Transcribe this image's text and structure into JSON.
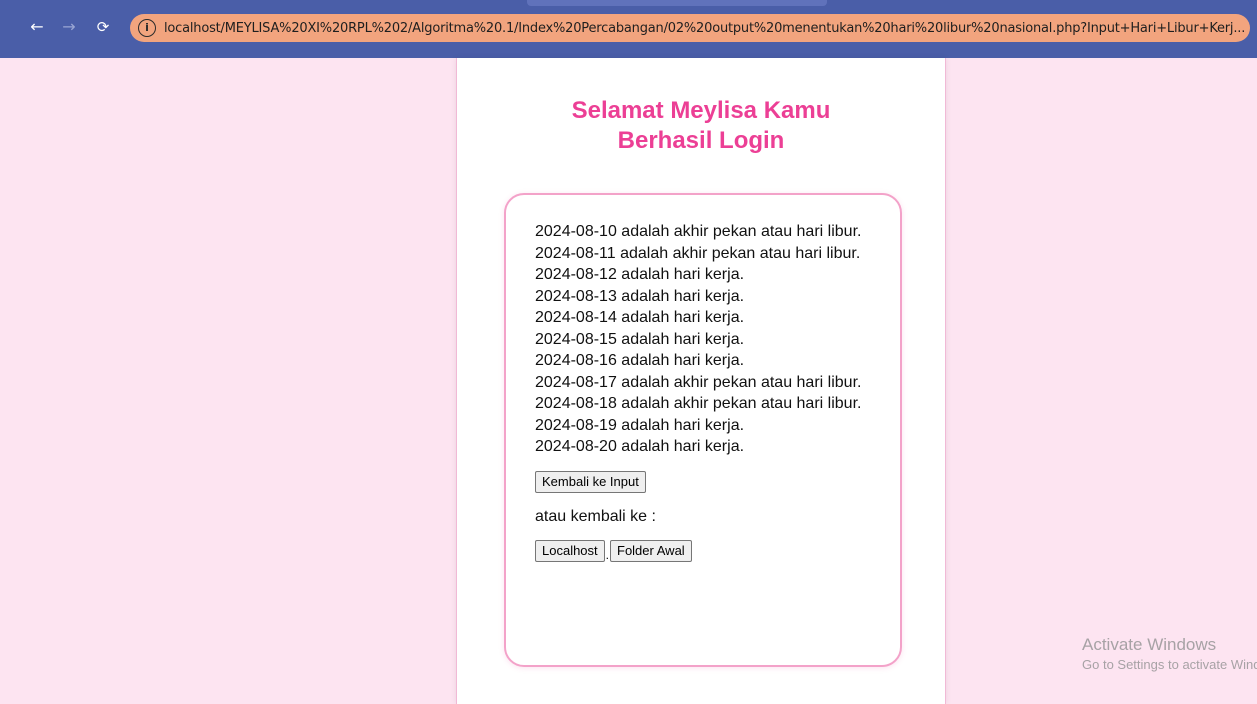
{
  "browser": {
    "url": "localhost/MEYLISA%20XI%20RPL%202/Algoritma%20.1/Index%20Percabangan/02%20output%20menentukan%20hari%20libur%20nasional.php?Input+Hari+Libur+Kerj..."
  },
  "page": {
    "title": "Selamat Meylisa Kamu Berhasil Login",
    "results": [
      "2024-08-10 adalah akhir pekan atau hari libur.",
      "2024-08-11 adalah akhir pekan atau hari libur.",
      "2024-08-12 adalah hari kerja.",
      "2024-08-13 adalah hari kerja.",
      "2024-08-14 adalah hari kerja.",
      "2024-08-15 adalah hari kerja.",
      "2024-08-16 adalah hari kerja.",
      "2024-08-17 adalah akhir pekan atau hari libur.",
      "2024-08-18 adalah akhir pekan atau hari libur.",
      "2024-08-19 adalah hari kerja.",
      "2024-08-20 adalah hari kerja."
    ],
    "back_button": "Kembali ke Input",
    "atau_text": "atau kembali ke :",
    "localhost_button": "Localhost",
    "separator": ".",
    "folder_button": "Folder Awal"
  },
  "watermark": {
    "title": "Activate Windows",
    "subtitle": "Go to Settings to activate Windows."
  },
  "colors": {
    "background": "#fde4f1",
    "toolbar": "#4a5ea8",
    "address_bar": "#f2a47e",
    "title": "#ec3f95",
    "card_border": "#f3a2c9"
  }
}
